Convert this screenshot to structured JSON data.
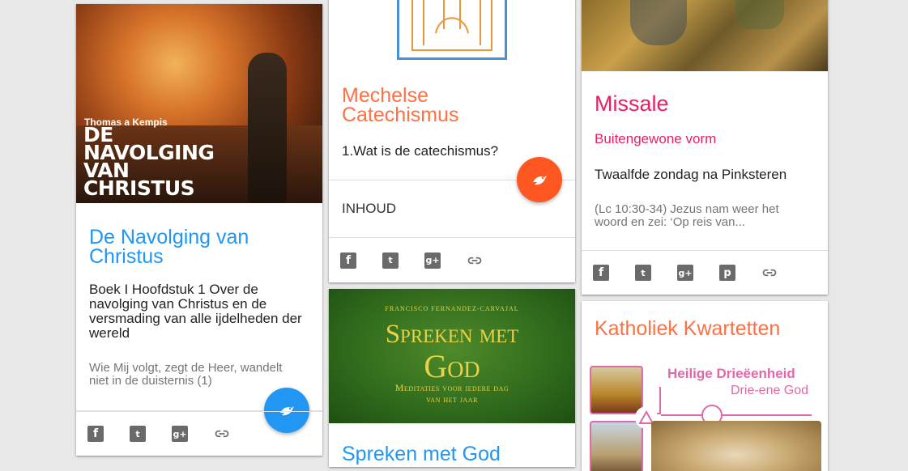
{
  "cards": {
    "navolging": {
      "cover": {
        "author": "Thomas a Kempis",
        "title_lines": [
          "DE",
          "NAVOLGING",
          "VAN",
          "CHRISTUS"
        ]
      },
      "title": "De Navolging van Christus",
      "subtitle": "Boek I Hoofdstuk 1 Over de navolging van Christus en de versmading van alle ijdelheden der wereld",
      "excerpt": "Wie Mij volgt, zegt de Heer, wandelt niet in de duisternis (1)",
      "accent": "#2196f3"
    },
    "catechismus": {
      "title": "Mechelse Catechismus",
      "subtitle": "1.Wat is de catechismus?",
      "index_label": "INHOUD",
      "accent": "#ff5722"
    },
    "spreken": {
      "cover": {
        "author": "Francisco Fernandez-Carvajal",
        "title_line1": "Spreken met",
        "title_line2": "God",
        "tagline_line1": "Meditaties voor iedere dag",
        "tagline_line2": "van het jaar"
      },
      "title": "Spreken met God"
    },
    "missale": {
      "title": "Missale",
      "form": "Buitengewone vorm",
      "day": "Twaalfde zondag na Pinksteren",
      "excerpt": "(Lc 10:30-34) Jezus nam weer het woord en zei: ‘Op reis van...",
      "accent": "#e91e63"
    },
    "kwartetten": {
      "title": "Katholiek Kwartetten",
      "card_title": "Heilige Drieëenheid",
      "card_sub": "Drie-ene God",
      "accent": "#ff7043",
      "card_color": "#e06aa6"
    }
  },
  "icons": [
    "facebook-icon",
    "twitter-icon",
    "google-plus-icon",
    "pinterest-icon",
    "link-icon",
    "dove-icon"
  ]
}
